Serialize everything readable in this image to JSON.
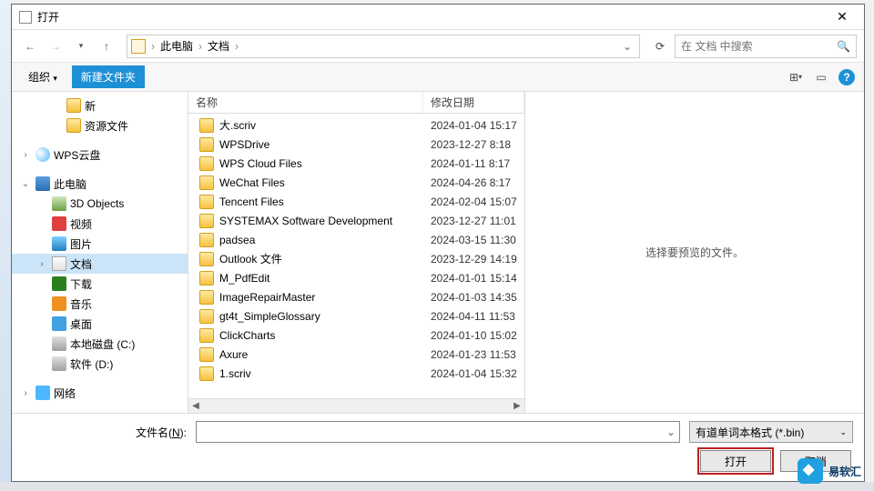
{
  "title": "打开",
  "breadcrumb": {
    "root": "此电脑",
    "folder": "文档"
  },
  "search": {
    "placeholder": "在 文档 中搜索"
  },
  "toolbar": {
    "organize": "组织",
    "newfolder": "新建文件夹"
  },
  "sidebar": [
    {
      "expander": "none",
      "indent": 34,
      "icon": "ic-folder",
      "label": "新"
    },
    {
      "expander": "none",
      "indent": 34,
      "icon": "ic-folder",
      "label": "资源文件"
    },
    {
      "expander": "right",
      "indent": 0,
      "icon": "ic-cloud",
      "label": "WPS云盘",
      "spacerBefore": true
    },
    {
      "expander": "down",
      "indent": 0,
      "icon": "ic-pc",
      "label": "此电脑",
      "spacerBefore": true
    },
    {
      "expander": "none",
      "indent": 18,
      "icon": "ic-3d",
      "label": "3D Objects"
    },
    {
      "expander": "none",
      "indent": 18,
      "icon": "ic-video",
      "label": "视频"
    },
    {
      "expander": "none",
      "indent": 18,
      "icon": "ic-img",
      "label": "图片"
    },
    {
      "expander": "right",
      "indent": 18,
      "icon": "ic-doc",
      "label": "文档",
      "selected": true
    },
    {
      "expander": "none",
      "indent": 18,
      "icon": "ic-down",
      "label": "下载"
    },
    {
      "expander": "none",
      "indent": 18,
      "icon": "ic-music",
      "label": "音乐"
    },
    {
      "expander": "none",
      "indent": 18,
      "icon": "ic-desk",
      "label": "桌面"
    },
    {
      "expander": "none",
      "indent": 18,
      "icon": "ic-drive",
      "label": "本地磁盘 (C:)"
    },
    {
      "expander": "none",
      "indent": 18,
      "icon": "ic-drive",
      "label": "软件 (D:)"
    },
    {
      "expander": "right",
      "indent": 0,
      "icon": "ic-net",
      "label": "网络",
      "spacerBefore": true
    }
  ],
  "columns": {
    "name": "名称",
    "date": "修改日期"
  },
  "files": [
    {
      "name": "大.scriv",
      "date": "2024-01-04 15:17"
    },
    {
      "name": "WPSDrive",
      "date": "2023-12-27 8:18"
    },
    {
      "name": "WPS Cloud Files",
      "date": "2024-01-11 8:17"
    },
    {
      "name": "WeChat Files",
      "date": "2024-04-26 8:17"
    },
    {
      "name": "Tencent Files",
      "date": "2024-02-04 15:07"
    },
    {
      "name": "SYSTEMAX Software Development",
      "date": "2023-12-27 11:01"
    },
    {
      "name": "padsea",
      "date": "2024-03-15 11:30"
    },
    {
      "name": "Outlook 文件",
      "date": "2023-12-29 14:19"
    },
    {
      "name": "M_PdfEdit",
      "date": "2024-01-01 15:14"
    },
    {
      "name": "ImageRepairMaster",
      "date": "2024-01-03 14:35"
    },
    {
      "name": "gt4t_SimpleGlossary",
      "date": "2024-04-11 11:53"
    },
    {
      "name": "ClickCharts",
      "date": "2024-01-10 15:02"
    },
    {
      "name": "Axure",
      "date": "2024-01-23 11:53"
    },
    {
      "name": "1.scriv",
      "date": "2024-01-04 15:32"
    }
  ],
  "preview": {
    "empty": "选择要预览的文件。"
  },
  "bottom": {
    "filename_label_pre": "文件名(",
    "filename_label_ul": "N",
    "filename_label_post": "):",
    "filter": "有道单词本格式 (*.bin)",
    "open": "打开",
    "cancel": "取消"
  },
  "watermark": "易软汇"
}
